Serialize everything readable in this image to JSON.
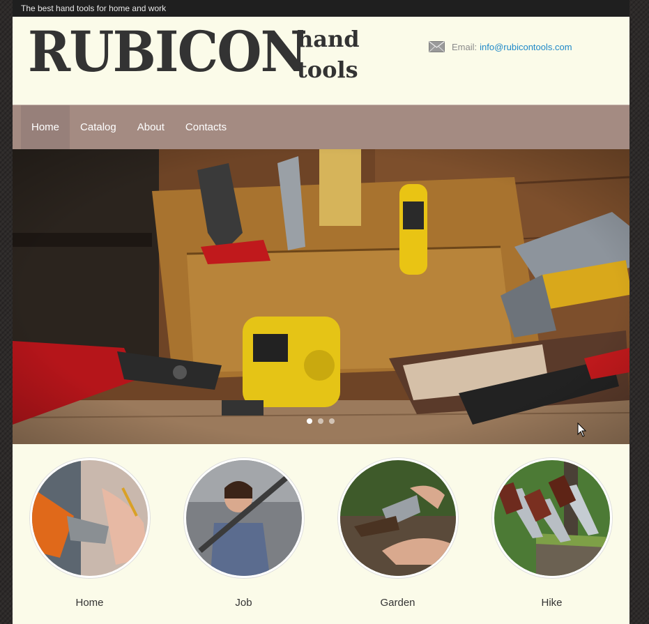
{
  "topbar": {
    "text": "The best hand tools for home and work"
  },
  "header": {
    "logo": "RUBICON",
    "tagline_line1": "hand",
    "tagline_line2": "tools",
    "email_label": "Email:",
    "email_value": "info@rubicontools.com",
    "email_icon": "envelope-icon"
  },
  "nav": {
    "items": [
      {
        "label": "Home",
        "active": true
      },
      {
        "label": "Catalog"
      },
      {
        "label": "About"
      },
      {
        "label": "Contacts"
      }
    ]
  },
  "hero": {
    "slide_count": 3,
    "active_slide": 1
  },
  "categories": [
    {
      "label": "Home"
    },
    {
      "label": "Job"
    },
    {
      "label": "Garden"
    },
    {
      "label": "Hike"
    }
  ],
  "colors": {
    "nav_bg": "#a48b82",
    "page_bg": "#fbfbe9",
    "link": "#1e88c8"
  }
}
